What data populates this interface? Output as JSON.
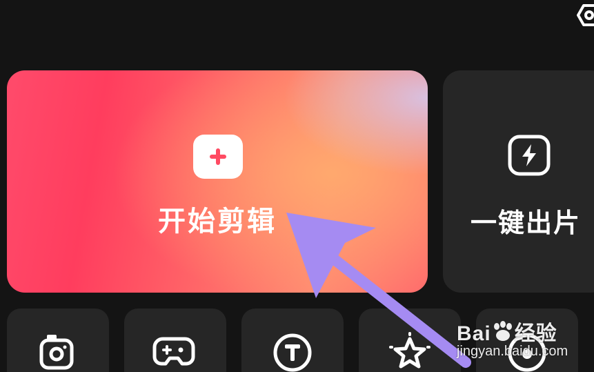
{
  "cards": {
    "start_edit_label": "开始剪辑",
    "one_click_label": "一键出片"
  },
  "tools": [
    {
      "icon": "camera-icon"
    },
    {
      "icon": "gamepad-icon"
    },
    {
      "icon": "text-t-icon"
    },
    {
      "icon": "sparkle-star-icon"
    },
    {
      "icon": "record-circle-icon"
    }
  ],
  "watermark": {
    "brand": "Bai",
    "brand_suffix": "经验",
    "url": "jingyan.baidu.com"
  },
  "colors": {
    "background": "#141414",
    "card_dark": "#262626",
    "accent_pink": "#ff3d5e",
    "accent_orange": "#ff8a72",
    "arrow_purple": "#a58bf2"
  }
}
